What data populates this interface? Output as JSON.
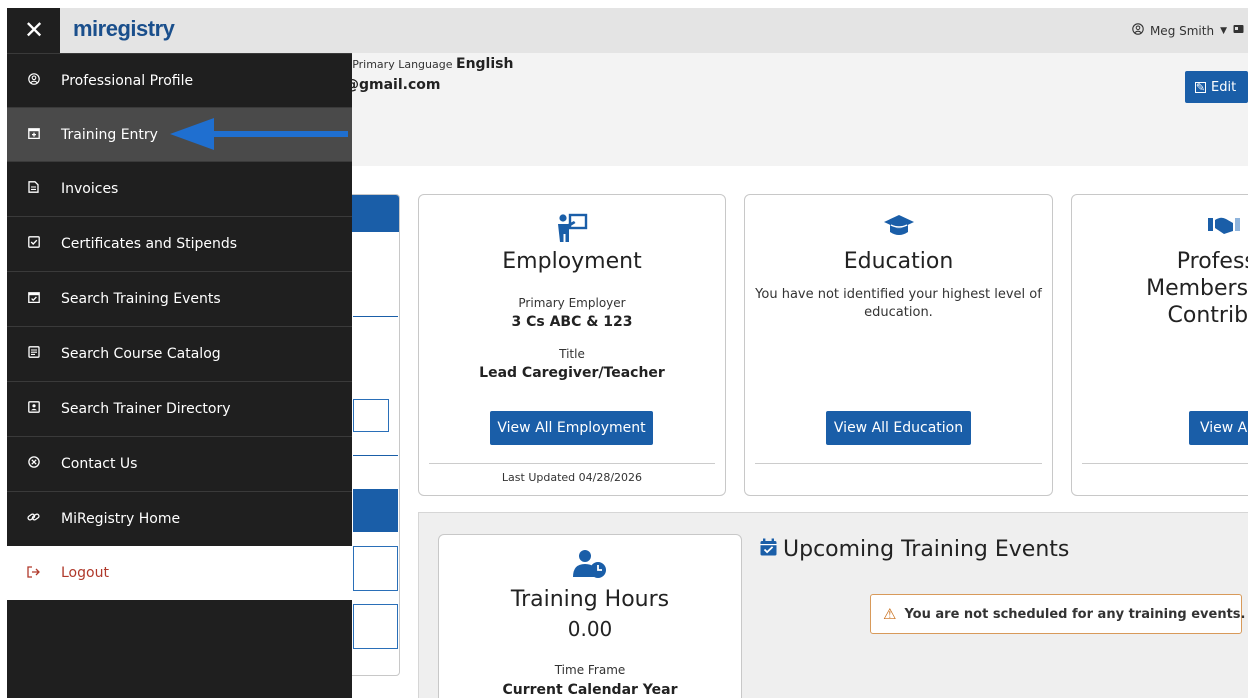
{
  "topbar": {
    "user_name": "Meg Smith",
    "user_icon": "user-circle-icon",
    "extra_icon": "card-icon"
  },
  "menu": {
    "close_label": "✕",
    "logo_text": "miregistry",
    "items": [
      {
        "label": "Professional Profile",
        "icon": "user-circle-icon"
      },
      {
        "label": "Training Entry",
        "icon": "calendar-plus-icon"
      },
      {
        "label": "Invoices",
        "icon": "document-icon"
      },
      {
        "label": "Certificates and Stipends",
        "icon": "check-square-icon"
      },
      {
        "label": "Search Training Events",
        "icon": "calendar-check-icon"
      },
      {
        "label": "Search Course Catalog",
        "icon": "catalog-icon"
      },
      {
        "label": "Search Trainer Directory",
        "icon": "id-card-icon"
      },
      {
        "label": "Contact Us",
        "icon": "x-circle-icon"
      },
      {
        "label": "MiRegistry Home",
        "icon": "link-icon"
      },
      {
        "label": "Logout",
        "icon": "logout-icon"
      }
    ]
  },
  "profile": {
    "lang_label": "/ Primary Language",
    "lang_value": "English",
    "email_partial": "@gmail.com",
    "edit_label": "Edit"
  },
  "employment": {
    "title": "Employment",
    "primary_employer_label": "Primary Employer",
    "primary_employer_value": "3 Cs ABC & 123",
    "title_label": "Title",
    "title_value": "Lead Caregiver/Teacher",
    "button_label": "View All Employment",
    "last_updated": "Last Updated 04/28/2026"
  },
  "education": {
    "title": "Education",
    "message": "You have not identified your highest level of education.",
    "button_label": "View All Education"
  },
  "membership": {
    "title_line1": "Professi",
    "title_line2": "Membersh",
    "title_line3": "Contribu",
    "button_label": "View A"
  },
  "training_hours": {
    "title": "Training Hours",
    "value": "0.00",
    "time_frame_label": "Time Frame",
    "time_frame_value": "Current Calendar Year"
  },
  "upcoming": {
    "title": "Upcoming Training Events",
    "alert": "You are not scheduled for any training events."
  },
  "colors": {
    "brand_blue": "#1a5ea8",
    "menu_bg": "#1f1f1f",
    "logout_red": "#b0392b",
    "arrow_blue": "#1f6fd0"
  }
}
